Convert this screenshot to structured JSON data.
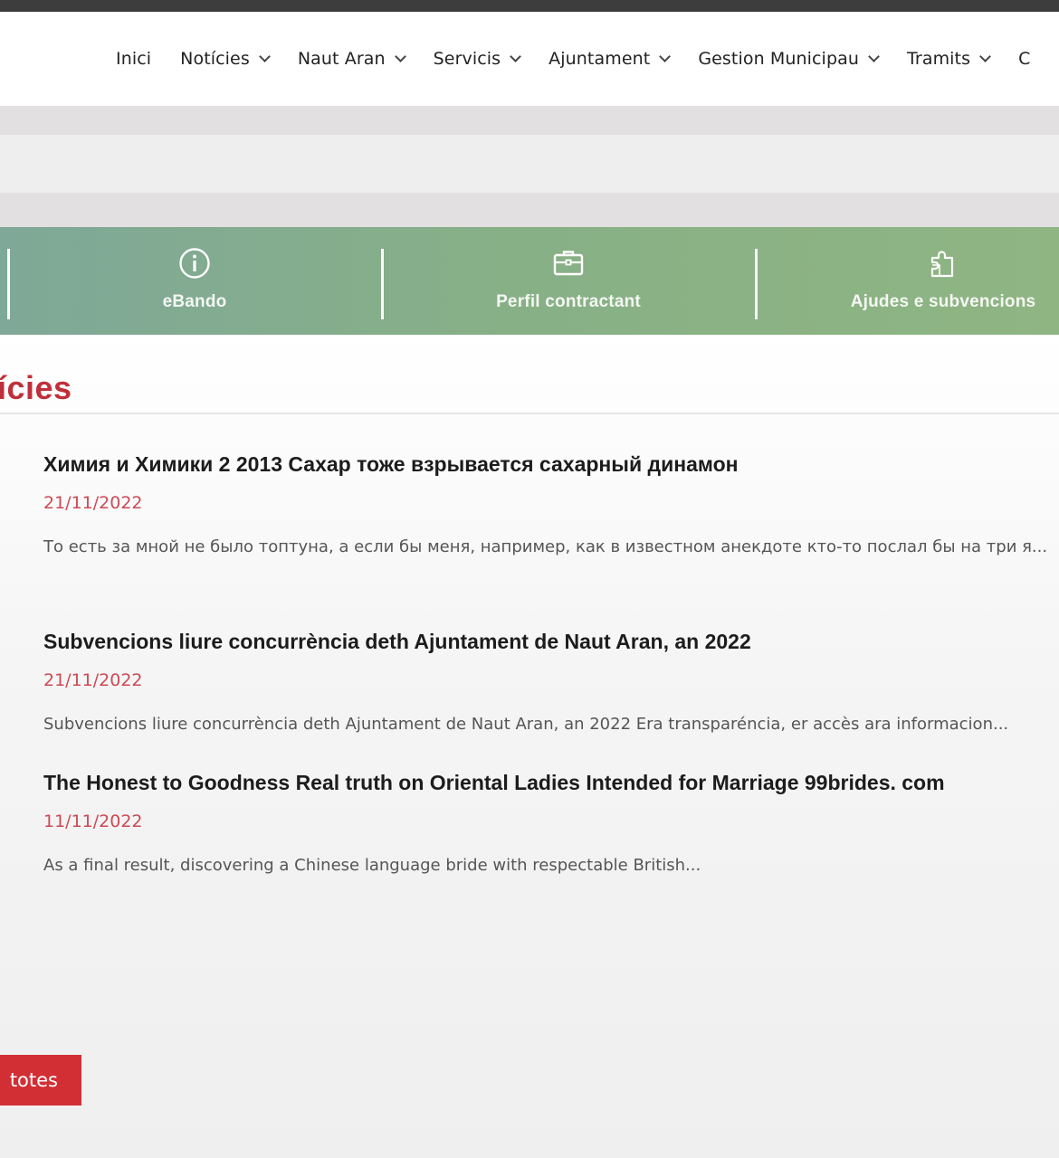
{
  "nav": {
    "items": [
      {
        "label": "Inici",
        "dropdown": false
      },
      {
        "label": "Notícies",
        "dropdown": true
      },
      {
        "label": "Naut Aran",
        "dropdown": true
      },
      {
        "label": "Servicis",
        "dropdown": true
      },
      {
        "label": "Ajuntament",
        "dropdown": true
      },
      {
        "label": "Gestion Municipau",
        "dropdown": true
      },
      {
        "label": "Tramits",
        "dropdown": true
      },
      {
        "label": "C",
        "dropdown": false
      }
    ]
  },
  "quicklinks": [
    {
      "label": "eBando",
      "icon": "info-circle-icon"
    },
    {
      "label": "Perfil contractant",
      "icon": "briefcase-icon"
    },
    {
      "label": "Ajudes e subvencions",
      "icon": "puzzle-icon"
    }
  ],
  "section": {
    "title": "ícies"
  },
  "news": [
    {
      "title": "Химия и Химики 2 2013 Сахар тоже взрывается сахарный динамон",
      "date": "21/11/2022",
      "excerpt": "То есть за мной не было топтуна, а если бы меня, например, как в известном анекдоте кто-то послал бы на три я..."
    },
    {
      "title": "Subvencions liure concurrència deth Ajuntament de Naut Aran, an 2022",
      "date": "21/11/2022",
      "excerpt": "Subvencions liure concurrència deth Ajuntament de Naut Aran, an 2022 Era transparéncia, er accès ara informacion..."
    },
    {
      "title": "The Honest to Goodness Real truth on Oriental Ladies Intended for Marriage 99brides. com",
      "date": "11/11/2022",
      "excerpt": "As a final result, discovering a Chinese language bride with respectable British..."
    }
  ],
  "more_button": {
    "label": "totes"
  },
  "colors": {
    "accent": "#c0303a",
    "button": "#d22f35",
    "quickbar_start": "#7fa898",
    "quickbar_end": "#8fb583"
  }
}
